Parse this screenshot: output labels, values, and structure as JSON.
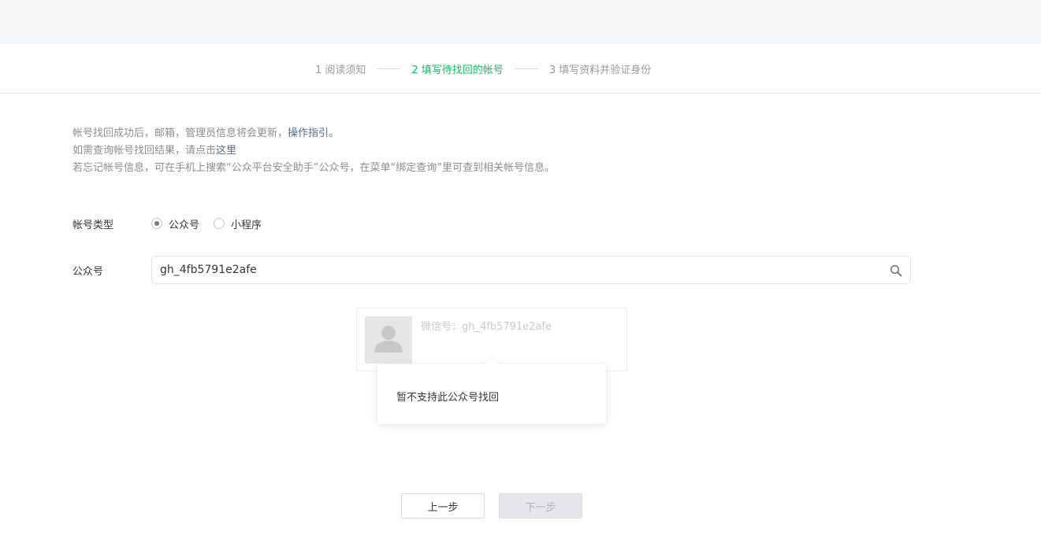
{
  "steps": [
    {
      "label": "1 阅读须知"
    },
    {
      "label": "2 填写待找回的帐号"
    },
    {
      "label": "3 填写资料并验证身份"
    }
  ],
  "notice": {
    "line1_text": "帐号找回成功后，邮箱，管理员信息将会更新，",
    "line1_link": "操作指引。",
    "line2_text": "如需查询帐号找回结果，请点击",
    "line2_link": "这里",
    "line3_text": "若忘记帐号信息，可在手机上搜索“公众平台安全助手”公众号，在菜单“绑定查询”里可查到相关帐号信息。"
  },
  "account_type": {
    "label": "帐号类型",
    "options": [
      {
        "label": "公众号",
        "checked": true
      },
      {
        "label": "小程序",
        "checked": false
      }
    ]
  },
  "account_field": {
    "label": "公众号",
    "value": "gh_4fb5791e2afe",
    "icon": "search-icon"
  },
  "result": {
    "wechat_id": "微信号：gh_4fb5791e2afe",
    "avatar_icon": "user-silhouette-icon"
  },
  "popover": {
    "message": "暂不支持此公众号找回"
  },
  "buttons": {
    "prev_label": "上一步",
    "next_label": "下一步"
  },
  "colors": {
    "active_step": "#07c160",
    "link": "#576b95",
    "disabled_button_bg": "#e7e7eb"
  }
}
